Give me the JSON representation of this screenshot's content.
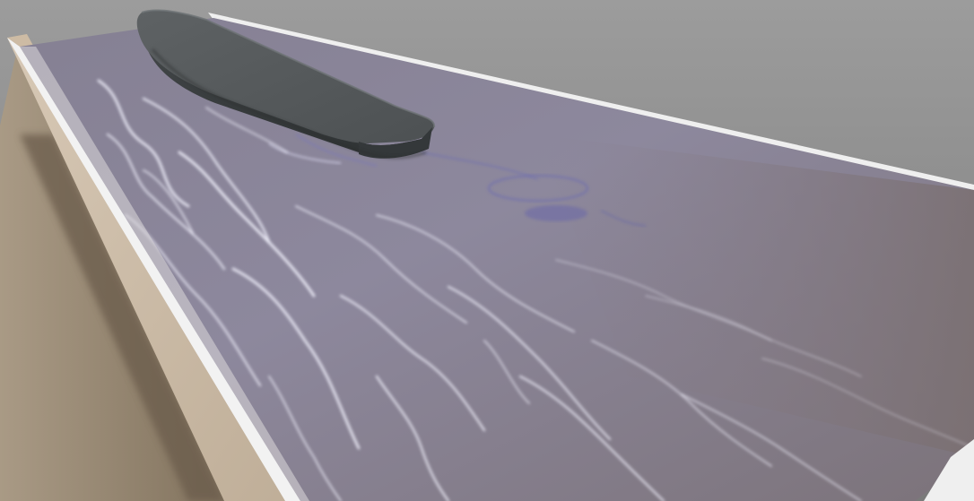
{
  "scene": {
    "subject": "ship-hull-in-wave-tank",
    "colors": {
      "sky_top": "#9a9a9a",
      "sky_bottom": "#7c7c7c",
      "floor_light": "#a99a85",
      "floor_dark": "#6f6050",
      "tank_wall_inner": "#c9b9a6",
      "tank_wall_shade": "#9c8c78",
      "tank_rim": "#eeeeee",
      "water_far": "#7f7883",
      "water_near": "#8a88a0",
      "water_highlight": "#f2f2ff",
      "hull_top": "#5c6062",
      "hull_side": "#3e4244",
      "foam": "#6a6aa8"
    }
  }
}
